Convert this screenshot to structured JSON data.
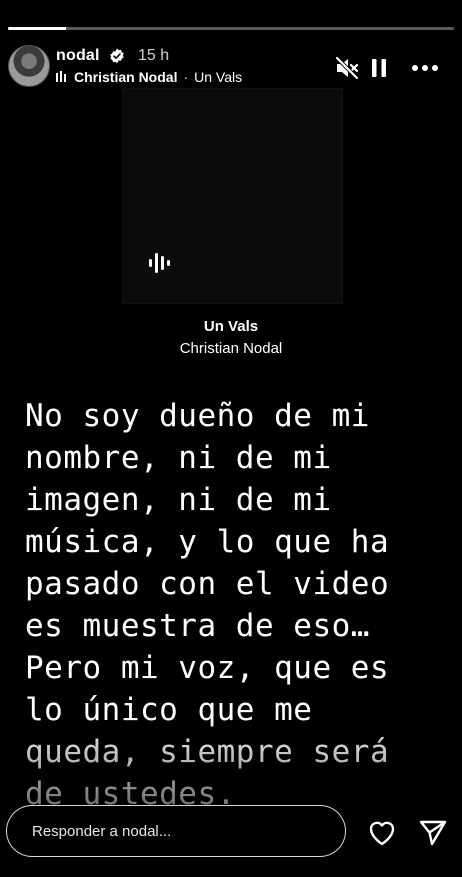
{
  "story": {
    "progress_fraction": 0.13,
    "user": {
      "username": "nodal",
      "verified": true,
      "time_ago": "15 h"
    },
    "music": {
      "icon": "music-bars-icon",
      "artist": "Christian Nodal",
      "separator": "·",
      "song": "Un Vals"
    },
    "controls": {
      "mute_icon": "muted-speaker-icon",
      "pause_icon": "pause-icon",
      "more_icon": "more-options-icon"
    },
    "sticker": {
      "title": "Un Vals",
      "artist": "Christian Nodal"
    },
    "text_lines": "No soy dueño de mi\nnombre, ni de mi\nimagen, ni de mi\nmúsica, y lo que ha\npasado con el video\nes muestra de eso…\nPero mi voz, que es\nlo único que me\nqueda, siempre será\nde ustedes.",
    "reply": {
      "placeholder": "Responder a nodal..."
    },
    "actions": {
      "like_icon": "heart-icon",
      "share_icon": "send-icon"
    }
  }
}
